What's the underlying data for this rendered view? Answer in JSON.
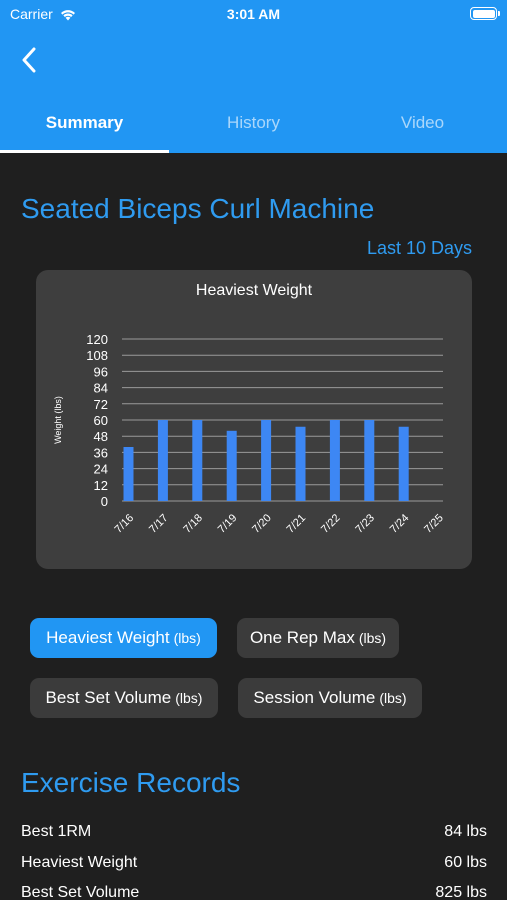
{
  "status_bar": {
    "carrier": "Carrier",
    "time": "3:01 AM"
  },
  "tabs": [
    {
      "label": "Summary",
      "active": true
    },
    {
      "label": "History",
      "active": false
    },
    {
      "label": "Video",
      "active": false
    }
  ],
  "exercise": {
    "title": "Seated Biceps Curl Machine",
    "range_label": "Last 10 Days"
  },
  "chart_data": {
    "type": "bar",
    "title": "Heaviest Weight",
    "ylabel": "Weight (lbs)",
    "xlabel": "",
    "categories": [
      "7/16",
      "7/17",
      "7/18",
      "7/19",
      "7/20",
      "7/21",
      "7/22",
      "7/23",
      "7/24",
      "7/25"
    ],
    "values": [
      40,
      60,
      60,
      52,
      60,
      55,
      60,
      60,
      55,
      0
    ],
    "ylim": [
      0,
      120
    ],
    "yticks": [
      0,
      12,
      24,
      36,
      48,
      60,
      72,
      84,
      96,
      108,
      120
    ],
    "grid": true,
    "bar_color": "#3d87f4"
  },
  "metric_buttons": [
    {
      "label": "Heaviest Weight",
      "unit": "(lbs)",
      "active": true
    },
    {
      "label": "One Rep Max",
      "unit": "(lbs)",
      "active": false
    },
    {
      "label": "Best Set Volume",
      "unit": "(lbs)",
      "active": false
    },
    {
      "label": "Session Volume",
      "unit": "(lbs)",
      "active": false
    }
  ],
  "records": {
    "title": "Exercise Records",
    "rows": [
      {
        "label": "Best 1RM",
        "value": "84 lbs"
      },
      {
        "label": "Heaviest Weight",
        "value": "60 lbs"
      },
      {
        "label": "Best Set Volume",
        "value": "825 lbs"
      }
    ]
  },
  "colors": {
    "header": "#2196f3",
    "accent": "#2f9bf0",
    "background": "#1f1f1f",
    "card": "#3e3e3e",
    "pill": "#3b3b3b"
  }
}
